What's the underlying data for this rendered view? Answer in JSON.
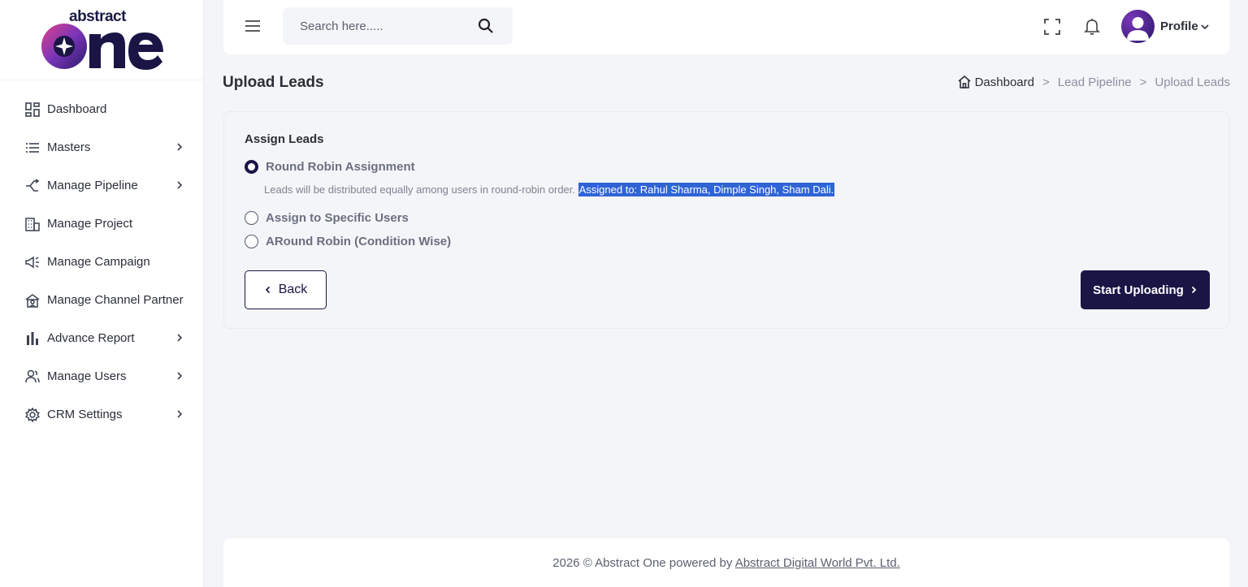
{
  "brand": {
    "logo_small_text": "abstract",
    "logo_big_text": "one",
    "primary_color": "#1a1545",
    "accent_gradient": [
      "#7a35b8",
      "#e0408a",
      "#2a1a6b"
    ]
  },
  "sidebar": {
    "items": [
      {
        "label": "Dashboard",
        "icon": "dashboard-icon",
        "has_submenu": false
      },
      {
        "label": "Masters",
        "icon": "list-icon",
        "has_submenu": true
      },
      {
        "label": "Manage Pipeline",
        "icon": "pipeline-icon",
        "has_submenu": true
      },
      {
        "label": "Manage Project",
        "icon": "building-icon",
        "has_submenu": false
      },
      {
        "label": "Manage Campaign",
        "icon": "megaphone-icon",
        "has_submenu": false
      },
      {
        "label": "Manage Channel Partner",
        "icon": "partner-icon",
        "has_submenu": false
      },
      {
        "label": "Advance Report",
        "icon": "bar-chart-icon",
        "has_submenu": true
      },
      {
        "label": "Manage Users",
        "icon": "users-icon",
        "has_submenu": true
      },
      {
        "label": "CRM Settings",
        "icon": "gear-icon",
        "has_submenu": true
      }
    ]
  },
  "topbar": {
    "search_placeholder": "Search here.....",
    "search_value": "",
    "profile_label": "Profile"
  },
  "page": {
    "title": "Upload Leads",
    "breadcrumb": [
      "Dashboard",
      "Lead Pipeline",
      "Upload Leads"
    ],
    "breadcrumb_separator": ">"
  },
  "assign": {
    "section_title": "Assign Leads",
    "options": [
      {
        "label": "Round Robin Assignment",
        "checked": true
      },
      {
        "label": "Assign to Specific Users",
        "checked": false
      },
      {
        "label": "ARound Robin (Condition Wise)",
        "checked": false
      }
    ],
    "hint_text": "Leads will be distributed equally among users in round-robin order. ",
    "hint_selected_text": "Assigned to: Rahul Sharma, Dimple Singh, Sham Dali."
  },
  "buttons": {
    "back_label": "Back",
    "start_label": "Start Uploading"
  },
  "footer": {
    "text": "2026 © Abstract One powered by ",
    "link_text": "Abstract Digital World Pvt. Ltd."
  }
}
